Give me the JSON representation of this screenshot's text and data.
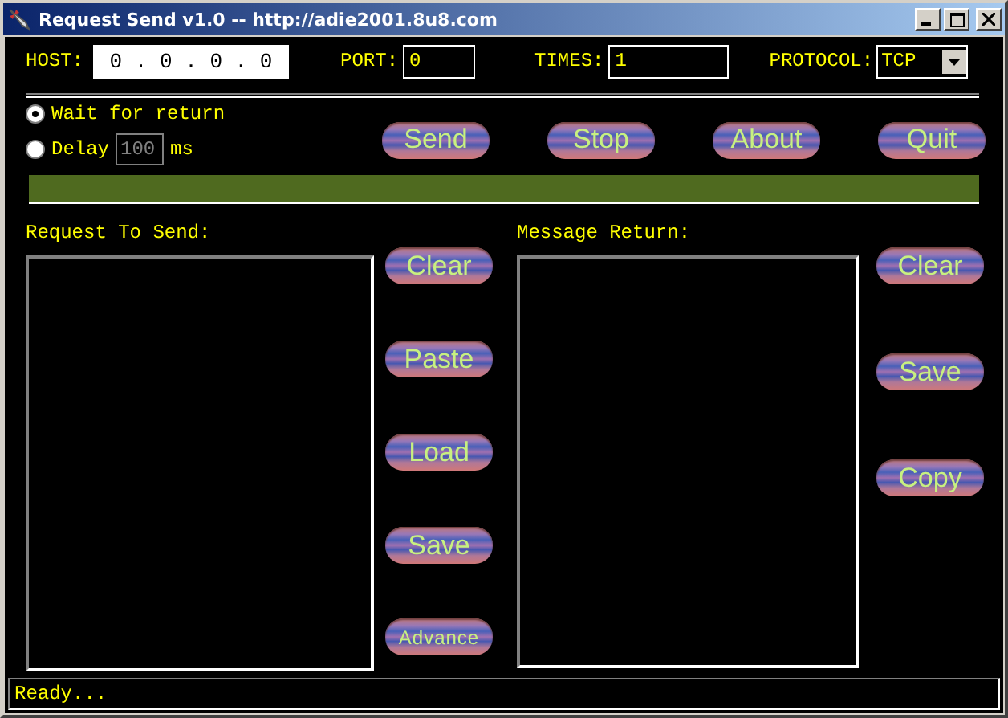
{
  "window": {
    "title": "Request Send v1.0 -- http://adie2001.8u8.com"
  },
  "connection": {
    "host_label": "HOST:",
    "host": "0 . 0 . 0 . 0",
    "port_label": "PORT:",
    "port": "0",
    "times_label": "TIMES:",
    "times": "1",
    "protocol_label": "PROTOCOL:",
    "protocol": "TCP"
  },
  "options": [
    {
      "kind": "plain",
      "label": "Wait for return",
      "selected": true
    },
    {
      "kind": "delay",
      "label": "Delay",
      "value": "100",
      "unit": "ms",
      "selected": false
    }
  ],
  "actions": [
    "Send",
    "Stop",
    "About",
    "Quit"
  ],
  "progress": {
    "level": 1
  },
  "request": {
    "label": "Request To Send:",
    "buttons": [
      "Clear",
      "Paste",
      "Load",
      "Save",
      "Advance"
    ]
  },
  "response": {
    "label": "Message Return:",
    "buttons": [
      "Clear",
      "Save",
      "Copy"
    ]
  },
  "status_bar": "Ready..."
}
